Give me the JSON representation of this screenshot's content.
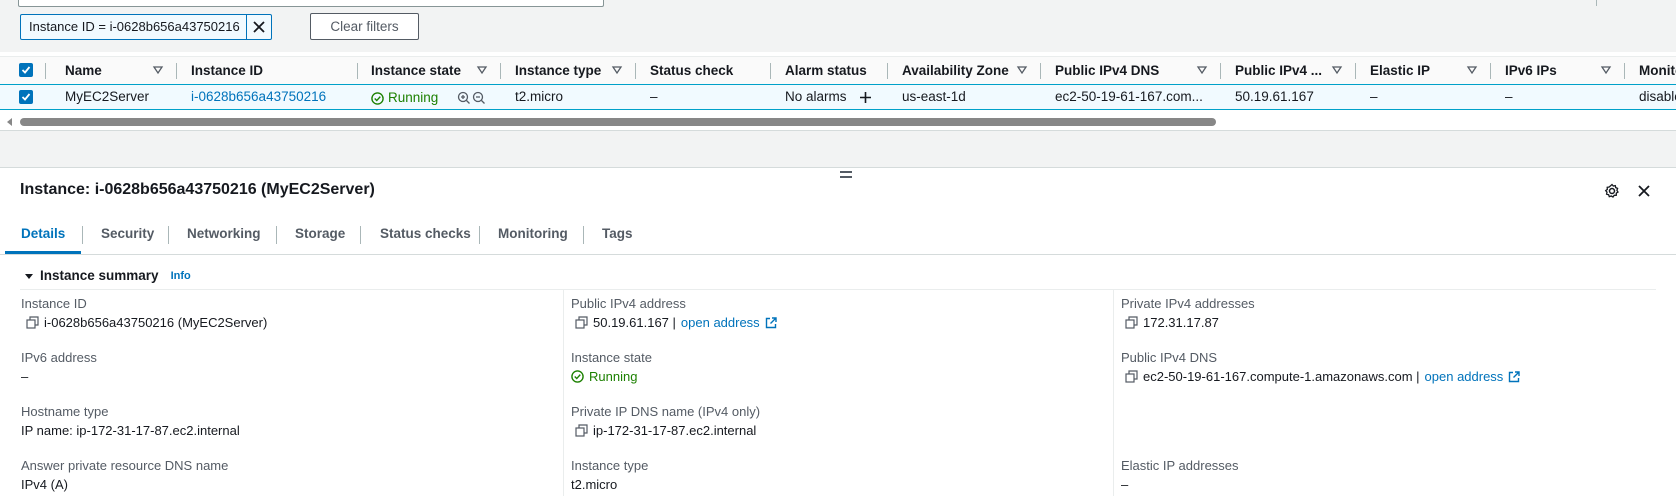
{
  "filter": {
    "token_text": "Instance ID = i-0628b656a43750216",
    "clear_label": "Clear filters"
  },
  "table": {
    "headers": [
      "Name",
      "Instance ID",
      "Instance state",
      "Instance type",
      "Status check",
      "Alarm status",
      "Availability Zone",
      "Public IPv4 DNS",
      "Public IPv4 ...",
      "Elastic IP",
      "IPv6 IPs",
      "Monito"
    ],
    "row": {
      "name": "MyEC2Server",
      "instance_id": "i-0628b656a43750216",
      "state": "Running",
      "type": "t2.micro",
      "status_check": "–",
      "alarm": "No alarms",
      "az": "us-east-1d",
      "public_dns": "ec2-50-19-61-167.com...",
      "public_ip": "50.19.61.167",
      "elastic_ip": "–",
      "ipv6": "–",
      "monitoring": "disable"
    }
  },
  "panel": {
    "title": "Instance: i-0628b656a43750216 (MyEC2Server)",
    "tabs": [
      "Details",
      "Security",
      "Networking",
      "Storage",
      "Status checks",
      "Monitoring",
      "Tags"
    ],
    "summary_title": "Instance summary",
    "info_label": "Info"
  },
  "details": {
    "instance_id_label": "Instance ID",
    "instance_id_value": "i-0628b656a43750216 (MyEC2Server)",
    "ipv6_label": "IPv6 address",
    "ipv6_value": "–",
    "hostname_type_label": "Hostname type",
    "hostname_type_value": "IP name: ip-172-31-17-87.ec2.internal",
    "answer_dns_label": "Answer private resource DNS name",
    "answer_dns_value": "IPv4 (A)",
    "public_ipv4_label": "Public IPv4 address",
    "public_ipv4_value": "50.19.61.167 |",
    "open_address": "open address",
    "instance_state_label": "Instance state",
    "instance_state_value": "Running",
    "private_dns_label": "Private IP DNS name (IPv4 only)",
    "private_dns_value": "ip-172-31-17-87.ec2.internal",
    "instance_type_label": "Instance type",
    "instance_type_value": "t2.micro",
    "private_ipv4_label": "Private IPv4 addresses",
    "private_ipv4_value": "172.31.17.87",
    "public_dns_label": "Public IPv4 DNS",
    "public_dns_value": "ec2-50-19-61-167.compute-1.amazonaws.com |",
    "elastic_ip_label": "Elastic IP addresses",
    "elastic_ip_value": "–"
  },
  "icons": [
    "close-icon",
    "sort-icon",
    "checkbox-icon",
    "status-ok-icon",
    "zoom-in-icon",
    "zoom-out-icon",
    "add-icon",
    "settings-icon",
    "copy-icon",
    "external-link-icon",
    "caret-down-icon"
  ],
  "colors": {
    "link": "#0073bb",
    "running": "#1d8102",
    "selected_row": "#f1faff"
  }
}
